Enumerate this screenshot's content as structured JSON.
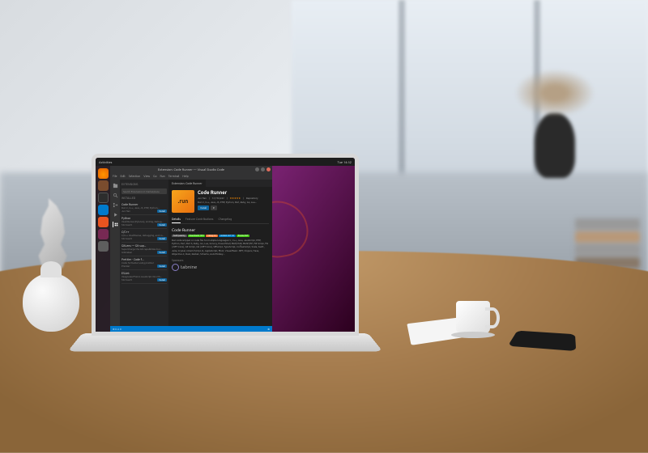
{
  "topbar": {
    "activities": "Activities",
    "app": "Visual Studio Code",
    "time": "Tue 14:32"
  },
  "dock": {
    "items": [
      "firefox",
      "files",
      "terminal",
      "vscode",
      "software",
      "help",
      "settings"
    ]
  },
  "vscode": {
    "title": "Extension: Code Runner — Visual Studio Code",
    "menu": [
      "File",
      "Edit",
      "Selection",
      "View",
      "Go",
      "Run",
      "Terminal",
      "Help"
    ],
    "sidebar": {
      "header": "Extensions",
      "search_placeholder": "Search Extensions in Marketplace",
      "section_installed": "INSTALLED",
      "items": [
        {
          "name": "Code Runner",
          "desc": "Run C, C++, Java, JS, PHP, Python...",
          "author": "Jun Han",
          "btn": "Install"
        },
        {
          "name": "Python",
          "desc": "IntelliSense (Pylance), Linting, Debug...",
          "author": "Microsoft",
          "btn": "Install"
        },
        {
          "name": "C/C++",
          "desc": "C/C++ IntelliSense, debugging, and co...",
          "author": "Microsoft",
          "btn": "Install"
        },
        {
          "name": "GitLens — Git sup...",
          "desc": "Supercharge the Git capabilities bui...",
          "author": "GitKraken",
          "btn": "Install"
        },
        {
          "name": "Prettier - Code f...",
          "desc": "Code formatter using prettier",
          "author": "Prettier",
          "btn": "Install"
        },
        {
          "name": "ESLint",
          "desc": "Integrates ESLint JavaScript into VS...",
          "author": "Microsoft",
          "btn": "Install"
        }
      ]
    },
    "tab": "Extension: Code Runner",
    "ext": {
      "logo": ".run",
      "name": "Code Runner",
      "author": "Jun Han",
      "installs": "12,759,942",
      "stars": "★★★★★",
      "repo": "Repository",
      "tagline": "Run C, C++, Java, JS, PHP, Python, Perl, Ruby, Go, Lua...",
      "install_btn": "Install",
      "dropdown": "▾",
      "detail_tabs": [
        "Details",
        "Feature Contributions",
        "Changelog"
      ],
      "readme_title": "Code Runner",
      "badges": [
        "build passing",
        "downloads 12M",
        "rating 4.5",
        "version v0.11.6",
        "license MIT"
      ],
      "readme_body": "Run code snippet or code file for multiple languages: C, C++, Java, JavaScript, PHP, Python, Perl, Perl 6, Ruby, Go, Lua, Groovy, PowerShell, BAT/CMD, BASH/SH, F# Script, F# (.NET Core), C# Script, C# (.NET Core), VBScript, TypeScript, CoffeeScript, Scala, Swift, Julia, Crystal, OCaml Script, R, AppleScript, Elixir, Visual Basic .NET, Clojure, Haxe, Objective-C, Rust, Racket, Scheme, AutoHotkey...",
      "sponsor_label": "Sponsors",
      "sponsor_name": "tabnine"
    },
    "status": {
      "left": "⊘ 0 ⚠ 0",
      "right": "⚙"
    }
  }
}
